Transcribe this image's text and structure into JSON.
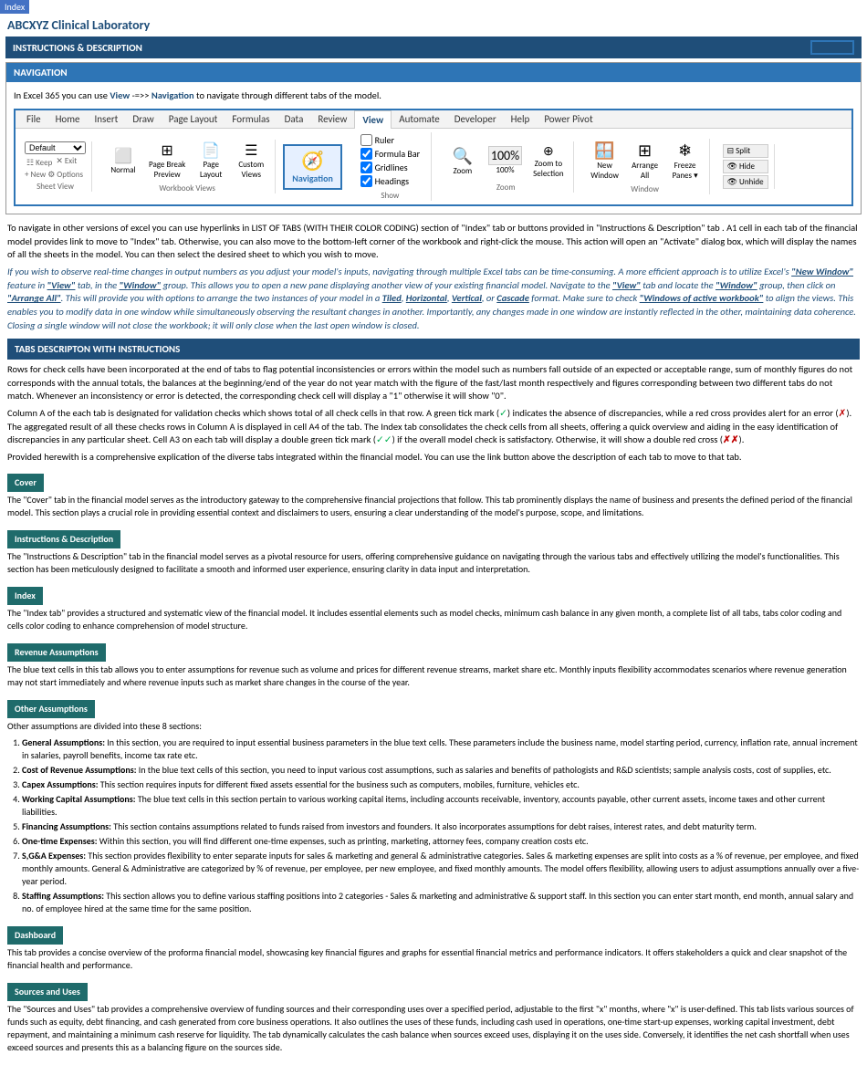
{
  "index_badge": "Index",
  "app_title": "ABCXYZ Clinical Laboratory",
  "instructions_header": "INSTRUCTIONS & DESCRIPTION",
  "navigation_section": {
    "header": "NAVIGATION",
    "intro": "In Excel 365 you can use View -=>> Navigation to navigate through different tabs of the model.",
    "view_label": "View",
    "navigation_label": "Navigation",
    "arrow_text": "->>"
  },
  "ribbon": {
    "tabs": [
      "File",
      "Home",
      "Insert",
      "Draw",
      "Page Layout",
      "Formulas",
      "Data",
      "Review",
      "View",
      "Automate",
      "Developer",
      "Help",
      "Power Pivot"
    ],
    "active_tab": "View",
    "sheet_view_group": {
      "label": "Sheet View",
      "dropdown_label": "Default",
      "buttons": [
        "Keep",
        "Exit",
        "New",
        "Options"
      ]
    },
    "workbook_views": {
      "label": "Workbook Views",
      "buttons": [
        "Normal",
        "Page Break Preview",
        "Page Layout",
        "Custom Views"
      ]
    },
    "active_button": "Navigation",
    "show_group": {
      "label": "Show",
      "checks": [
        "Ruler",
        "Formula Bar",
        "Gridlines",
        "Headings"
      ]
    },
    "zoom_group": {
      "label": "Zoom",
      "buttons": [
        "Zoom",
        "100%",
        "Zoom to Selection"
      ]
    },
    "window_group": {
      "label": "Window",
      "buttons": [
        "New Window",
        "Arrange All",
        "Freeze Panes"
      ]
    },
    "split_group": {
      "buttons": [
        "Split",
        "Hide",
        "Unhide"
      ]
    }
  },
  "main_paragraphs": [
    "To navigate in other versions of excel you can use hyperlinks in LIST OF TABS (WITH THEIR COLOR CODING) section of \"Index\" tab or buttons provided in \"Instructions & Description\" tab . A1 cell in each tab of the financial model provides link to move to \"Index\" tab. Otherwise, you can also move to the bottom-left corner of the workbook and right-click the mouse. This action will open an \"Activate\" dialog box, which will display the names of all the sheets in the model. You can then select the desired sheet to which you wish to move.",
    "If you wish to observe real-time changes in output numbers as you adjust your model's inputs, navigating through multiple Excel tabs can be time-consuming. A more efficient approach is to utilize Excel's \"New Window\" feature in \"View\" tab, in the \"Window\" group. This allows you to open a new pane displaying another view of your existing financial model. Navigate to the \"View\" tab and locate the \"Window\" group, then click on \"Arrange All\". This will provide you with options to arrange the two instances of your model in a Tiled, Horizontal, Vertical, or Cascade format. Make sure to check \"Windows of active workbook\" to align the views. This enables you to modify data in one window while simultaneously observing the resultant changes in another. Importantly, any changes made in one window are instantly reflected in the other, maintaining data coherence. Closing a single window will not close the workbook; it will only close when the last open window is closed."
  ],
  "tabs_section": {
    "header": "TABS DESCRIPTON WITH INSTRUCTIONS",
    "intro_paragraphs": [
      "Rows for check cells have been incorporated at the end of tabs to flag potential inconsistencies or errors within the model such as numbers fall outside of an expected or acceptable range, sum of monthly figures do not corresponds with the annual totals, the balances at the beginning/end of the year do not year match with the figure of the fast/last month respectively and figures corresponding between two different tabs do not match. Whenever an inconsistency or error is detected, the corresponding check cell will display a \"1\" otherwise it will show \"0\".",
      "Column A of the each tab is designated for validation checks which shows total of all check cells in that row. A green tick mark (✓) indicates the absence of discrepancies, while a red cross provides alert for an error (✗). The aggregated result of all these checks rows in Column A is displayed in cell A4 of the tab. The Index tab consolidates the check cells from all sheets, offering a quick overview and aiding in the easy identification of discrepancies in any particular sheet. Cell A3 on each tab will display a double green tick mark (✓✓) if the overall model check is satisfactory. Otherwise, it will show a double red cross (✗✗).",
      "Provided herewith is a comprehensive explication of the diverse tabs integrated within the financial model. You can use the link button above the description of each tab to move to that tab."
    ],
    "tabs": [
      {
        "name": "Cover",
        "description": "The \"Cover\" tab in the financial model serves as the introductory gateway to the comprehensive financial projections that follow. This tab prominently displays the name of business and presents the defined period of the financial model. This section plays a crucial role in providing essential context and disclaimers to users, ensuring a clear understanding of the model's purpose, scope, and limitations."
      },
      {
        "name": "Instructions & Description",
        "description": "The \"Instructions & Description\" tab in the financial model serves as a pivotal resource for users, offering comprehensive guidance on navigating through the various tabs and effectively utilizing the model's functionalities. This section has been meticulously designed to facilitate a smooth and informed user experience, ensuring clarity in data input and interpretation."
      },
      {
        "name": "Index",
        "description": "The \"Index tab\" provides a structured and systematic view of the financial model. It includes essential elements such as model checks, minimum cash balance in any given month, a complete list of all tabs, tabs color coding and cells color coding to enhance comprehension of model structure."
      },
      {
        "name": "Revenue Assumptions",
        "description": "The blue text cells in this tab allows you to enter assumptions for revenue such as volume and prices for different revenue streams, market share etc. Monthly inputs flexibility accommodates scenarios where revenue generation may not start immediately and where revenue inputs such as market share changes in the course of the year."
      },
      {
        "name": "Other Assumptions",
        "description": "Other assumptions are divided into these 8 sections:",
        "assumptions": [
          "General Assumptions: In this section, you are required to input essential business parameters in the blue text cells. These parameters include the business name, model starting period, currency, inflation rate, annual increment in salaries, payroll benefits, income tax rate etc.",
          "Cost of Revenue Assumptions: In the blue text cells of this section, you need to input various cost assumptions, such as salaries and benefits of pathologists and R&D scientists; sample analysis costs, cost of supplies, etc.",
          "Capex Assumptions: This section requires inputs for different fixed assets essential for the business such as computers, mobiles, furniture, vehicles etc.",
          "Working Capital Assumptions: The blue text cells in this section pertain to various working capital items, including accounts receivable, inventory, accounts payable, other current assets, income taxes and other current liabilities.",
          "Financing Assumptions: This section contains assumptions related to funds raised from investors and founders. It also incorporates assumptions for debt raises, interest rates, and debt maturity term.",
          "One-time Expenses: Within this section, you will find different one-time expenses, such as printing, marketing, attorney fees, company creation costs etc.",
          "S,G&A Expenses: This section provides flexibility to enter separate inputs for sales & marketing and general & administrative categories. Sales & marketing expenses are split into costs as a % of revenue, per employee, and fixed monthly amounts. General & Administrative are categorized by % of revenue, per employee, per new employee, and fixed monthly amounts. The model offers flexibility, allowing users to adjust assumptions annually over a five-year period.",
          "Staffing Assumptions: This section allows you to define various staffing positions into 2 categories - Sales & marketing and administrative & support staff. In this section you can enter start month, end month, annual salary and no. of employee hired at the same time for the same position."
        ]
      },
      {
        "name": "Dashboard",
        "description": "This tab provides a concise overview of the proforma financial model, showcasing key financial figures and graphs for essential financial metrics and performance indicators. It offers stakeholders a quick and clear snapshot of the financial health and performance."
      },
      {
        "name": "Sources and Uses",
        "description": "The \"Sources and Uses\" tab provides a comprehensive overview of funding sources and their corresponding uses over a specified period, adjustable to the first \"x\" months, where \"x\" is user-defined. This tab lists various sources of funds such as equity, debt financing, and cash generated from core business operations. It also outlines the uses of these funds, including cash used in operations, one-time start-up expenses, working capital investment, debt repayment, and maintaining a minimum cash reserve for liquidity. The tab dynamically calculates the cash balance when sources exceed uses, displaying it on the uses side. Conversely, it identifies the net cash shortfall when uses exceed sources and presents this as a balancing figure on the sources side."
      }
    ]
  }
}
